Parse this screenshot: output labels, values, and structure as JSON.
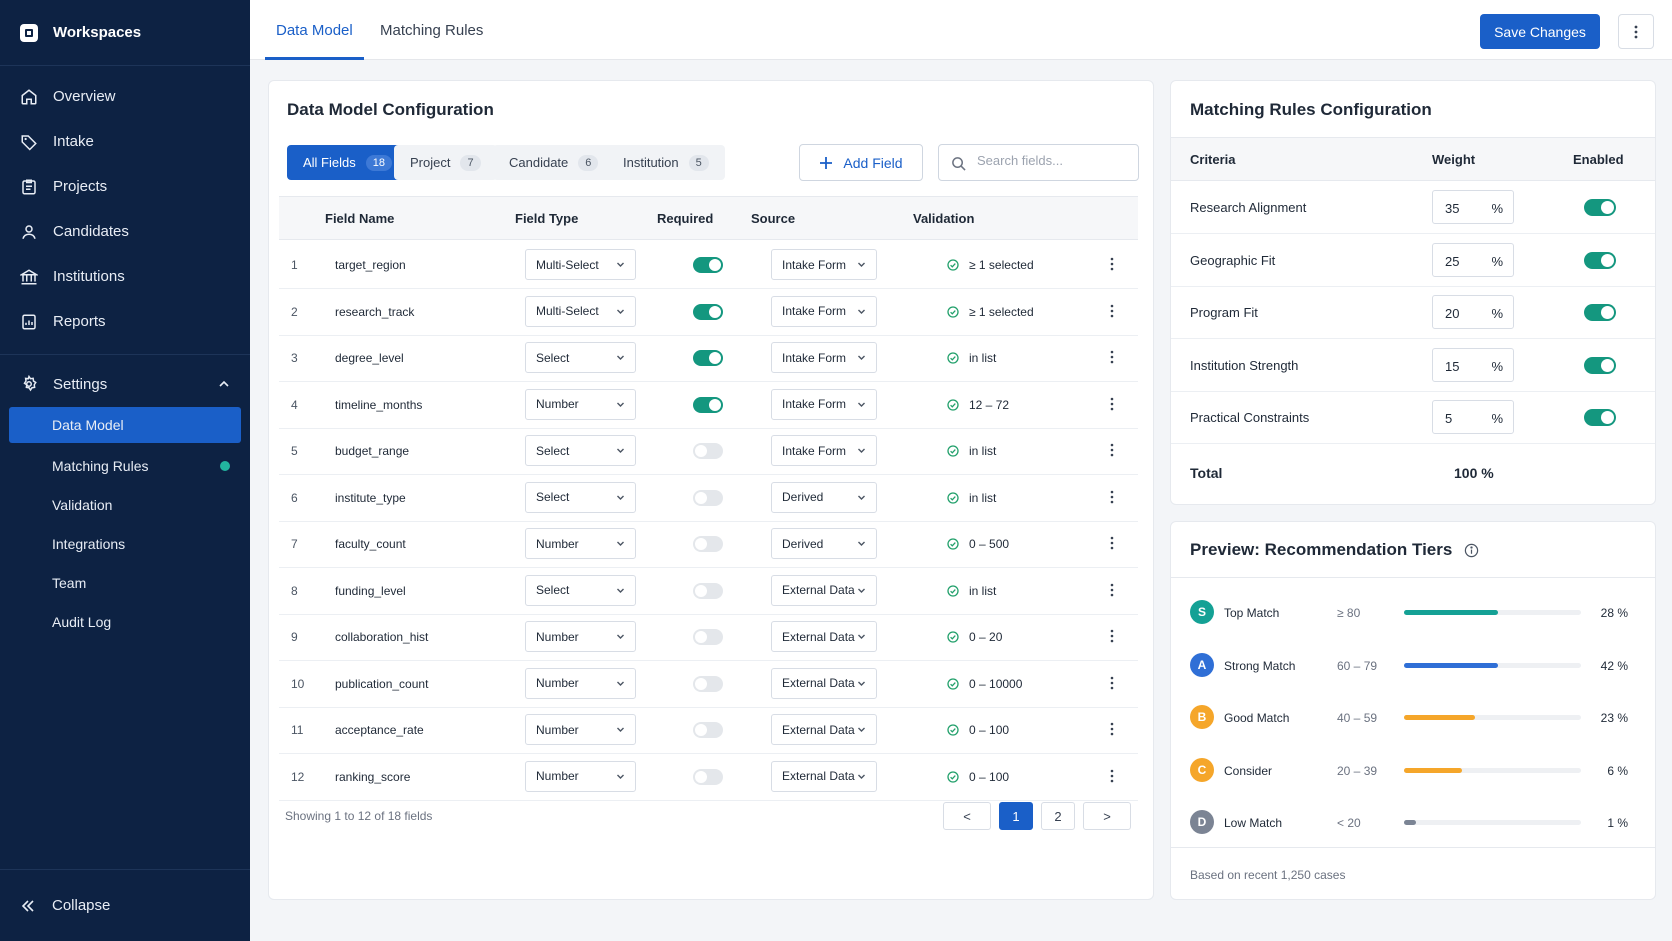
{
  "sidebar": {
    "workspace": "Workspaces",
    "nav": [
      {
        "label": "Overview",
        "icon": "home-icon"
      },
      {
        "label": "Intake",
        "icon": "tag-icon"
      },
      {
        "label": "Projects",
        "icon": "clipboard-icon"
      },
      {
        "label": "Candidates",
        "icon": "user-icon"
      },
      {
        "label": "Institutions",
        "icon": "bank-icon"
      },
      {
        "label": "Reports",
        "icon": "report-icon"
      }
    ],
    "settings_label": "Settings",
    "sub": [
      {
        "label": "Data Model",
        "active": true
      },
      {
        "label": "Matching Rules",
        "dot": true
      },
      {
        "label": "Validation"
      },
      {
        "label": "Integrations"
      },
      {
        "label": "Team"
      },
      {
        "label": "Audit Log"
      }
    ],
    "collapse": "Collapse"
  },
  "topbar": {
    "tabs": [
      "Data Model",
      "Matching Rules"
    ],
    "save": "Save Changes"
  },
  "data_model": {
    "title": "Data Model Configuration",
    "filters": [
      {
        "label": "All Fields",
        "count": "18"
      },
      {
        "label": "Project",
        "count": "7"
      },
      {
        "label": "Candidate",
        "count": "6"
      },
      {
        "label": "Institution",
        "count": "5"
      }
    ],
    "add_field": "Add Field",
    "search_placeholder": "Search fields...",
    "columns": [
      "Field Name",
      "Field Type",
      "Required",
      "Source",
      "Validation"
    ],
    "rows": [
      {
        "n": "1",
        "name": "target_region",
        "type": "Multi-Select",
        "required": true,
        "source": "Intake Form",
        "validation": "≥ 1 selected"
      },
      {
        "n": "2",
        "name": "research_track",
        "type": "Multi-Select",
        "required": true,
        "source": "Intake Form",
        "validation": "≥ 1 selected"
      },
      {
        "n": "3",
        "name": "degree_level",
        "type": "Select",
        "required": true,
        "source": "Intake Form",
        "validation": "in list"
      },
      {
        "n": "4",
        "name": "timeline_months",
        "type": "Number",
        "required": true,
        "source": "Intake Form",
        "validation": "12 – 72"
      },
      {
        "n": "5",
        "name": "budget_range",
        "type": "Select",
        "required": false,
        "source": "Intake Form",
        "validation": "in list"
      },
      {
        "n": "6",
        "name": "institute_type",
        "type": "Select",
        "required": false,
        "source": "Derived",
        "validation": "in list"
      },
      {
        "n": "7",
        "name": "faculty_count",
        "type": "Number",
        "required": false,
        "source": "Derived",
        "validation": "0 – 500"
      },
      {
        "n": "8",
        "name": "funding_level",
        "type": "Select",
        "required": false,
        "source": "External Data",
        "validation": "in list"
      },
      {
        "n": "9",
        "name": "collaboration_hist",
        "type": "Number",
        "required": false,
        "source": "External Data",
        "validation": "0 – 20"
      },
      {
        "n": "10",
        "name": "publication_count",
        "type": "Number",
        "required": false,
        "source": "External Data",
        "validation": "0 – 10000"
      },
      {
        "n": "11",
        "name": "acceptance_rate",
        "type": "Number",
        "required": false,
        "source": "External Data",
        "validation": "0 – 100"
      },
      {
        "n": "12",
        "name": "ranking_score",
        "type": "Number",
        "required": false,
        "source": "External Data",
        "validation": "0 – 100"
      }
    ],
    "showing": "Showing 1 to 12 of 18 fields",
    "pages": [
      "1",
      "2"
    ],
    "prev": "<",
    "next": ">"
  },
  "matching": {
    "title": "Matching Rules Configuration",
    "columns": [
      "Criteria",
      "Weight",
      "Enabled"
    ],
    "rows": [
      {
        "criteria": "Research Alignment",
        "weight": "35",
        "unit": "%",
        "enabled": true
      },
      {
        "criteria": "Geographic Fit",
        "weight": "25",
        "unit": "%",
        "enabled": true
      },
      {
        "criteria": "Program Fit",
        "weight": "20",
        "unit": "%",
        "enabled": true
      },
      {
        "criteria": "Institution Strength",
        "weight": "15",
        "unit": "%",
        "enabled": true
      },
      {
        "criteria": "Practical Constraints",
        "weight": "5",
        "unit": "%",
        "enabled": true
      }
    ],
    "total_label": "Total",
    "total_value": "100 %"
  },
  "preview": {
    "title": "Preview: Recommendation Tiers",
    "tiers": [
      {
        "badge": "S",
        "name": "Top Match",
        "range": "≥ 80",
        "pct": "28 %",
        "fill": 0.53,
        "color": "#14a195"
      },
      {
        "badge": "A",
        "name": "Strong Match",
        "range": "60 – 79",
        "pct": "42 %",
        "fill": 0.53,
        "color": "#2f6fd6"
      },
      {
        "badge": "B",
        "name": "Good Match",
        "range": "40 – 59",
        "pct": "23 %",
        "fill": 0.4,
        "color": "#f5a62a"
      },
      {
        "badge": "C",
        "name": "Consider",
        "range": "20 – 39",
        "pct": "6 %",
        "fill": 0.33,
        "color": "#f5a62a"
      },
      {
        "badge": "D",
        "name": "Low Match",
        "range": "< 20",
        "pct": "1 %",
        "fill": 0.07,
        "color": "#7b8494"
      }
    ],
    "footer": "Based on recent 1,250 cases"
  },
  "colors": {
    "accent": "#1a5fc8",
    "sidebar": "#0d2243",
    "toggle_on": "#14977f"
  }
}
